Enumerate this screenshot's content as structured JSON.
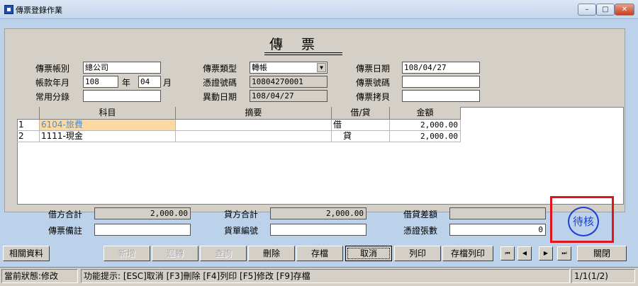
{
  "window": {
    "title": "傳票登錄作業",
    "min": "–",
    "max": "□",
    "close": "✕"
  },
  "form": {
    "title": "傳 票",
    "left": {
      "account_label": "傳票帳別",
      "account_value": "總公司",
      "period_label": "帳款年月",
      "year_value": "108",
      "year_unit": "年",
      "month_value": "04",
      "month_unit": "月",
      "common_label": "常用分錄",
      "common_value": ""
    },
    "mid": {
      "type_label": "傳票類型",
      "type_value": "轉帳",
      "voucher_label": "憑證號碼",
      "voucher_value": "10804270001",
      "change_label": "異動日期",
      "change_value": "108/04/27"
    },
    "right": {
      "date_label": "傳票日期",
      "date_value": "108/04/27",
      "number_label": "傳票號碼",
      "number_value": "",
      "copy_label": "傳票拷貝",
      "copy_value": ""
    }
  },
  "grid": {
    "headers": {
      "subject": "科目",
      "summary": "摘要",
      "dc": "借/貸",
      "amount": "金額"
    },
    "rows": [
      {
        "no": "1",
        "subject": "6104-旅費",
        "summary": "",
        "dc": "借",
        "amount": "2,000.00"
      },
      {
        "no": "2",
        "subject": "1111-現金",
        "summary": "",
        "dc": "貸",
        "amount": "2,000.00"
      }
    ]
  },
  "totals": {
    "debit_label": "借方合計",
    "debit_value": "2,000.00",
    "credit_label": "貸方合計",
    "credit_value": "2,000.00",
    "diff_label": "借貸差額",
    "diff_value": "",
    "note_label": "傳票備註",
    "note_value": "",
    "bill_label": "貨單編號",
    "bill_value": "",
    "count_label": "憑證張數",
    "count_value": "0"
  },
  "stamp": {
    "text": "待核",
    "color": "#1a3fd6",
    "box_color": "#e0141c"
  },
  "buttons": {
    "related": "相關資料",
    "add": "新增",
    "reverse": "迴轉",
    "query": "查詢",
    "delete": "刪除",
    "save": "存檔",
    "cancel": "取消",
    "print": "列印",
    "save_print": "存檔列印",
    "close": "關閉"
  },
  "nav": {
    "first": "⏮",
    "prev": "◀",
    "next": "▶",
    "last": "⏭"
  },
  "status": {
    "state": "當前狀態:修改",
    "hint": "功能提示: [ESC]取消 [F3]刪除 [F4]列印 [F5]修改 [F9]存檔",
    "page": "1/1(1/2)"
  }
}
